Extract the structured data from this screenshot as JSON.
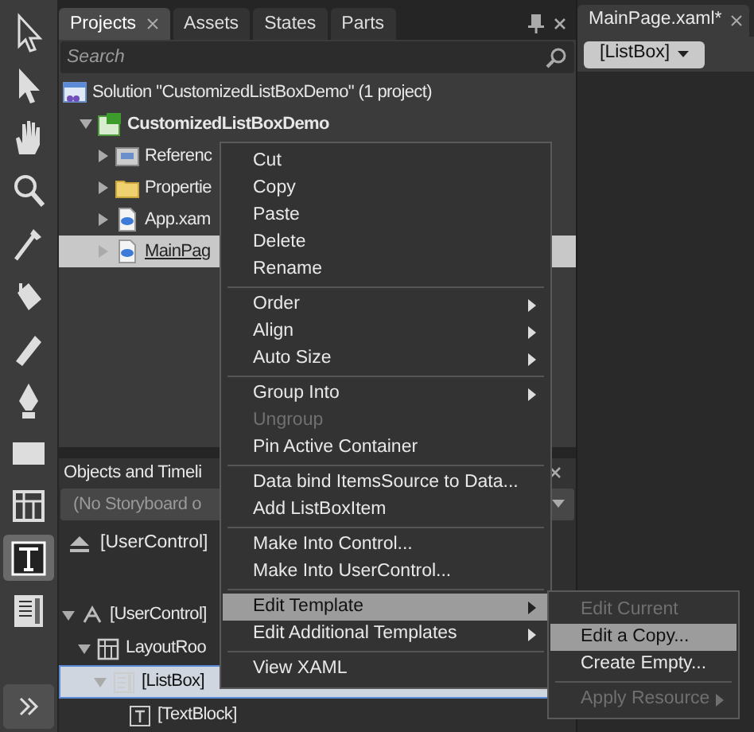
{
  "toolbox": {
    "tools": [
      {
        "kind": "arrow",
        "selected": false
      },
      {
        "kind": "direct",
        "selected": false
      },
      {
        "kind": "hand",
        "selected": false
      },
      {
        "kind": "zoom",
        "selected": false
      },
      {
        "kind": "eyedropper",
        "selected": false
      },
      {
        "kind": "bucket",
        "selected": false
      },
      {
        "kind": "brush",
        "selected": false
      },
      {
        "kind": "pen",
        "selected": false
      },
      {
        "kind": "rectangle",
        "selected": false
      },
      {
        "kind": "grid",
        "selected": false
      },
      {
        "kind": "text",
        "selected": true
      },
      {
        "kind": "listbox",
        "selected": false
      }
    ]
  },
  "projects_panel": {
    "tabs": [
      {
        "label": "Projects",
        "selected": true
      },
      {
        "label": "Assets",
        "selected": false
      },
      {
        "label": "States",
        "selected": false
      },
      {
        "label": "Parts",
        "selected": false
      }
    ],
    "search": {
      "placeholder": "Search"
    },
    "tree": [
      {
        "label": "Solution \"CustomizedListBoxDemo\" (1 project)",
        "kind": "solution",
        "selected": false,
        "children": [
          {
            "label": "CustomizedListBoxDemo",
            "kind": "project",
            "expanded": true,
            "selected": false,
            "children": [
              {
                "label": "Referenc",
                "kind": "references",
                "expanded": false,
                "selected": false
              },
              {
                "label": "Propertie",
                "kind": "folder",
                "expanded": false,
                "selected": false
              },
              {
                "label": "App.xam",
                "kind": "xaml",
                "expanded": false,
                "selected": false
              },
              {
                "label": "MainPag",
                "kind": "xaml",
                "expanded": false,
                "selected": true
              }
            ]
          }
        ]
      }
    ]
  },
  "objects_panel": {
    "title": "Objects and Timeli",
    "storyboard": {
      "value": "(No Storyboard o"
    },
    "scope": "[UserControl]",
    "tree": [
      {
        "label": "[UserControl]",
        "kind": "usercontrol",
        "expanded": true,
        "selected": false,
        "children": [
          {
            "label": "LayoutRoo",
            "kind": "grid",
            "expanded": true,
            "selected": false,
            "children": [
              {
                "label": "[ListBox]",
                "kind": "listbox",
                "expanded": true,
                "selected": true,
                "children": [
                  {
                    "label": "[TextBlock]",
                    "kind": "textblock",
                    "selected": false
                  }
                ]
              }
            ]
          }
        ]
      }
    ]
  },
  "context_menu": {
    "groups": [
      [
        {
          "label": "Cut",
          "disabled": false,
          "submenu": false,
          "selected": false
        },
        {
          "label": "Copy",
          "disabled": false,
          "submenu": false,
          "selected": false
        },
        {
          "label": "Paste",
          "disabled": false,
          "submenu": false,
          "selected": false
        },
        {
          "label": "Delete",
          "disabled": false,
          "submenu": false,
          "selected": false
        },
        {
          "label": "Rename",
          "disabled": false,
          "submenu": false,
          "selected": false
        }
      ],
      [
        {
          "label": "Order",
          "disabled": false,
          "submenu": true,
          "selected": false
        },
        {
          "label": "Align",
          "disabled": false,
          "submenu": true,
          "selected": false
        },
        {
          "label": "Auto Size",
          "disabled": false,
          "submenu": true,
          "selected": false
        }
      ],
      [
        {
          "label": "Group Into",
          "disabled": false,
          "submenu": true,
          "selected": false
        },
        {
          "label": "Ungroup",
          "disabled": true,
          "submenu": false,
          "selected": false
        },
        {
          "label": "Pin Active Container",
          "disabled": false,
          "submenu": false,
          "selected": false
        }
      ],
      [
        {
          "label": "Data bind ItemsSource to Data...",
          "disabled": false,
          "submenu": false,
          "selected": false
        },
        {
          "label": "Add ListBoxItem",
          "disabled": false,
          "submenu": false,
          "selected": false
        }
      ],
      [
        {
          "label": "Make Into Control...",
          "disabled": false,
          "submenu": false,
          "selected": false
        },
        {
          "label": "Make Into UserControl...",
          "disabled": false,
          "submenu": false,
          "selected": false
        }
      ],
      [
        {
          "label": "Edit Template",
          "disabled": false,
          "submenu": true,
          "selected": true
        },
        {
          "label": "Edit Additional Templates",
          "disabled": false,
          "submenu": true,
          "selected": false
        }
      ],
      [
        {
          "label": "View XAML",
          "disabled": false,
          "submenu": false,
          "selected": false
        }
      ]
    ]
  },
  "submenu": {
    "groups": [
      [
        {
          "label": "Edit Current",
          "disabled": true,
          "submenu": false,
          "selected": false
        },
        {
          "label": "Edit a Copy...",
          "disabled": false,
          "submenu": false,
          "selected": true
        },
        {
          "label": "Create Empty...",
          "disabled": false,
          "submenu": false,
          "selected": false
        }
      ],
      [
        {
          "label": "Apply Resource",
          "disabled": true,
          "submenu": true,
          "selected": false
        }
      ]
    ]
  },
  "designer": {
    "tab": {
      "label": "MainPage.xaml*"
    },
    "breadcrumb": "[ListBox]"
  }
}
